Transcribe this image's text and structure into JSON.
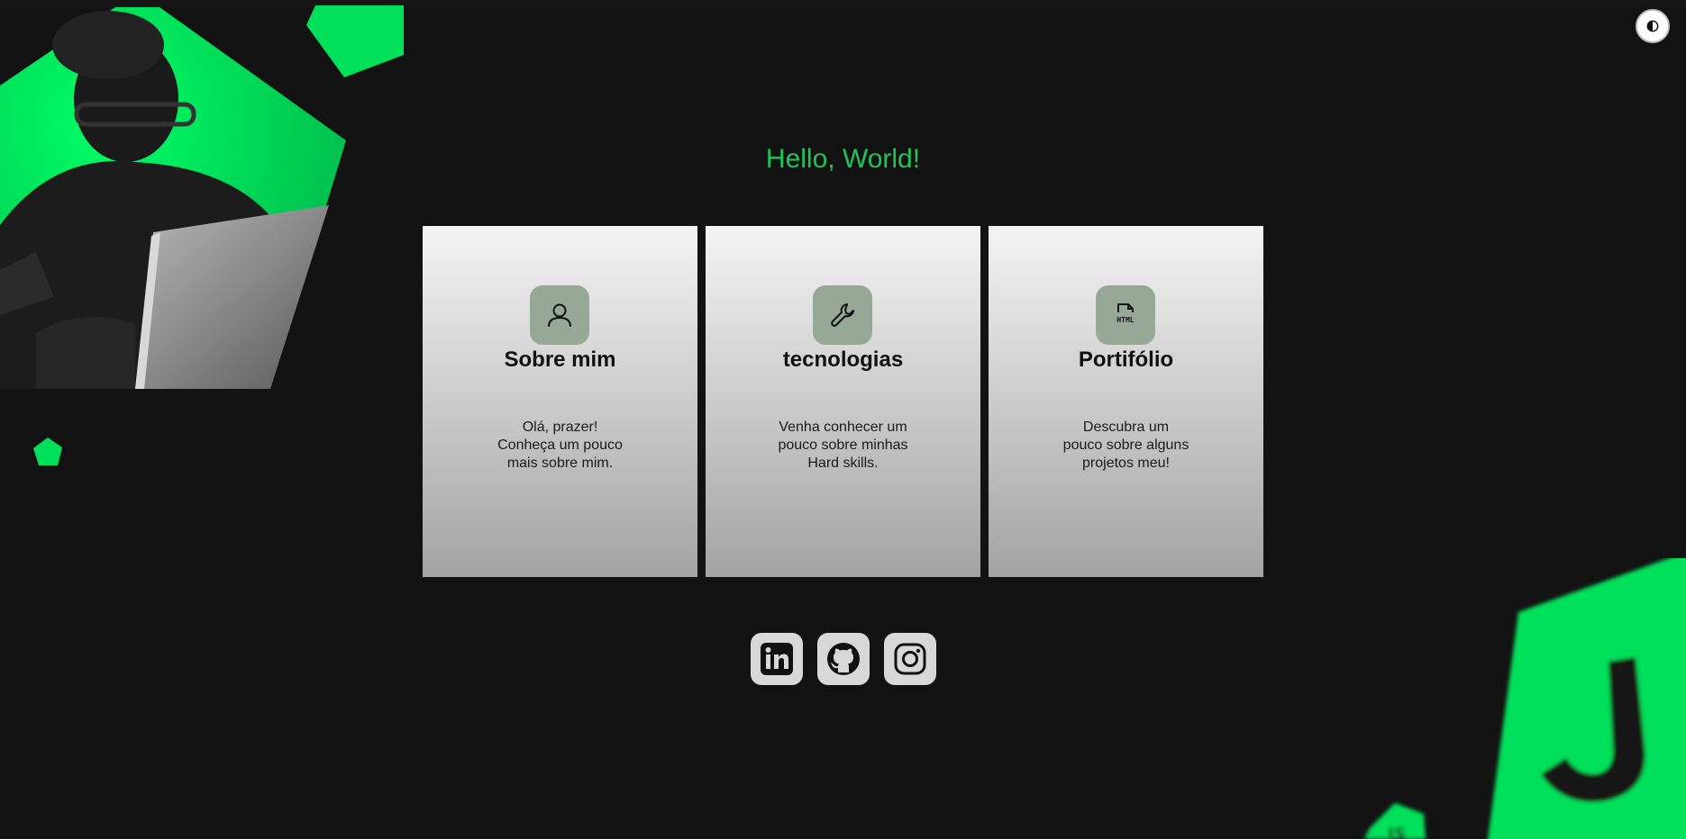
{
  "theme_toggle": {
    "icon": "contrast-icon"
  },
  "greeting": "Hello, World!",
  "cards": [
    {
      "icon": "user-icon",
      "title": "Sobre mim",
      "desc_lines": [
        "Olá, prazer!",
        "Conheça um pouco",
        "mais sobre mim."
      ]
    },
    {
      "icon": "wrench-icon",
      "title": "tecnologias",
      "desc_lines": [
        "Venha conhecer um",
        "pouco sobre minhas",
        "Hard skills."
      ]
    },
    {
      "icon": "html-file-icon",
      "title": "Portifólio",
      "desc_lines": [
        "Descubra um",
        "pouco sobre alguns",
        "projetos meu!"
      ]
    }
  ],
  "socials": [
    {
      "icon": "linkedin-icon"
    },
    {
      "icon": "github-icon"
    },
    {
      "icon": "instagram-icon"
    }
  ],
  "colors": {
    "background": "#121212",
    "accent_green": "#00e05a",
    "greeting": "#20c55a",
    "icon_tile": "#98a896",
    "social_tile": "#d8d8d8"
  }
}
